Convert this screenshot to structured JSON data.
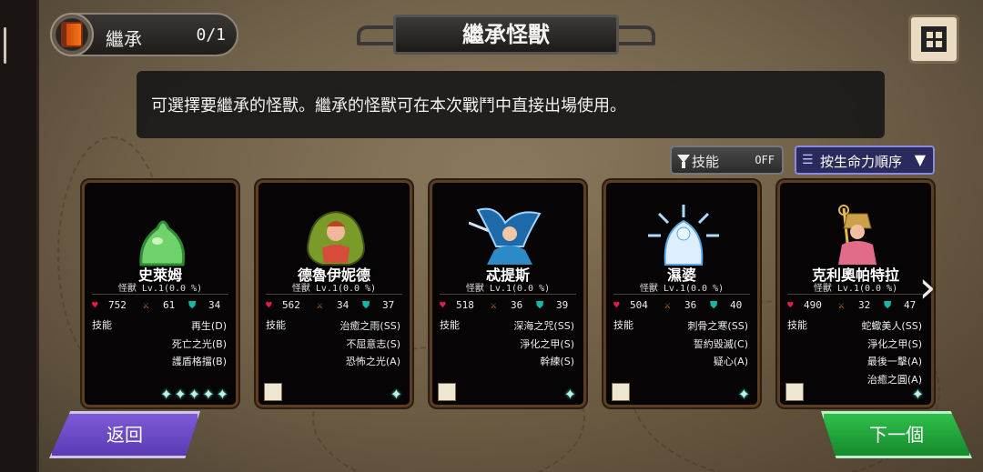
{
  "header": {
    "inherit_label": "繼承",
    "inherit_count": "0/1",
    "title": "繼承怪獸"
  },
  "message": "可選擇要繼承的怪獸。繼承的怪獸可在本次戰鬥中直接出場使用。",
  "filter": {
    "label": "技能",
    "state": "OFF"
  },
  "sort": {
    "label": "按生命力順序",
    "arrow": "▼",
    "icon": "sort-icon"
  },
  "monsters": [
    {
      "name": "史萊姆",
      "level": "怪獸 Lv.1(0.0 %)",
      "hp": "752",
      "atk": "61",
      "def": "34",
      "skill_label": "技能",
      "skills": [
        "再生(D)",
        "死亡之光(B)",
        "護盾格擋(B)"
      ],
      "stars": "✦✦✦✦✦",
      "rarity": 5
    },
    {
      "name": "德魯伊妮德",
      "level": "怪獸 Lv.1(0.0 %)",
      "hp": "562",
      "atk": "34",
      "def": "37",
      "skill_label": "技能",
      "skills": [
        "治癒之雨(SS)",
        "不屈意志(S)",
        "恐怖之光(A)"
      ],
      "stars": "✦",
      "rarity": 1
    },
    {
      "name": "忒提斯",
      "level": "怪獸 Lv.1(0.0 %)",
      "hp": "518",
      "atk": "36",
      "def": "39",
      "skill_label": "技能",
      "skills": [
        "深海之咒(SS)",
        "淨化之甲(S)",
        "幹練(S)"
      ],
      "stars": "✦",
      "rarity": 1
    },
    {
      "name": "濕婆",
      "level": "怪獸 Lv.1(0.0 %)",
      "hp": "504",
      "atk": "36",
      "def": "40",
      "skill_label": "技能",
      "skills": [
        "刺骨之寒(SS)",
        "誓約毀滅(C)",
        "疑心(A)"
      ],
      "stars": "✦",
      "rarity": 1
    },
    {
      "name": "克利奧帕特拉",
      "level": "怪獸 Lv.1(0.0 %)",
      "hp": "490",
      "atk": "32",
      "def": "47",
      "skill_label": "技能",
      "skills": [
        "蛇蠍美人(SS)",
        "淨化之甲(S)",
        "最後一擊(A)",
        "治癒之圓(A)"
      ],
      "stars": "✦",
      "rarity": 1
    }
  ],
  "buttons": {
    "back": "返回",
    "next": "下一個"
  },
  "colors": {
    "back_button": "#6a48c8",
    "next_button": "#22a43a",
    "sort_button": "#2a2a5c",
    "card_border": "#5a3d22"
  }
}
